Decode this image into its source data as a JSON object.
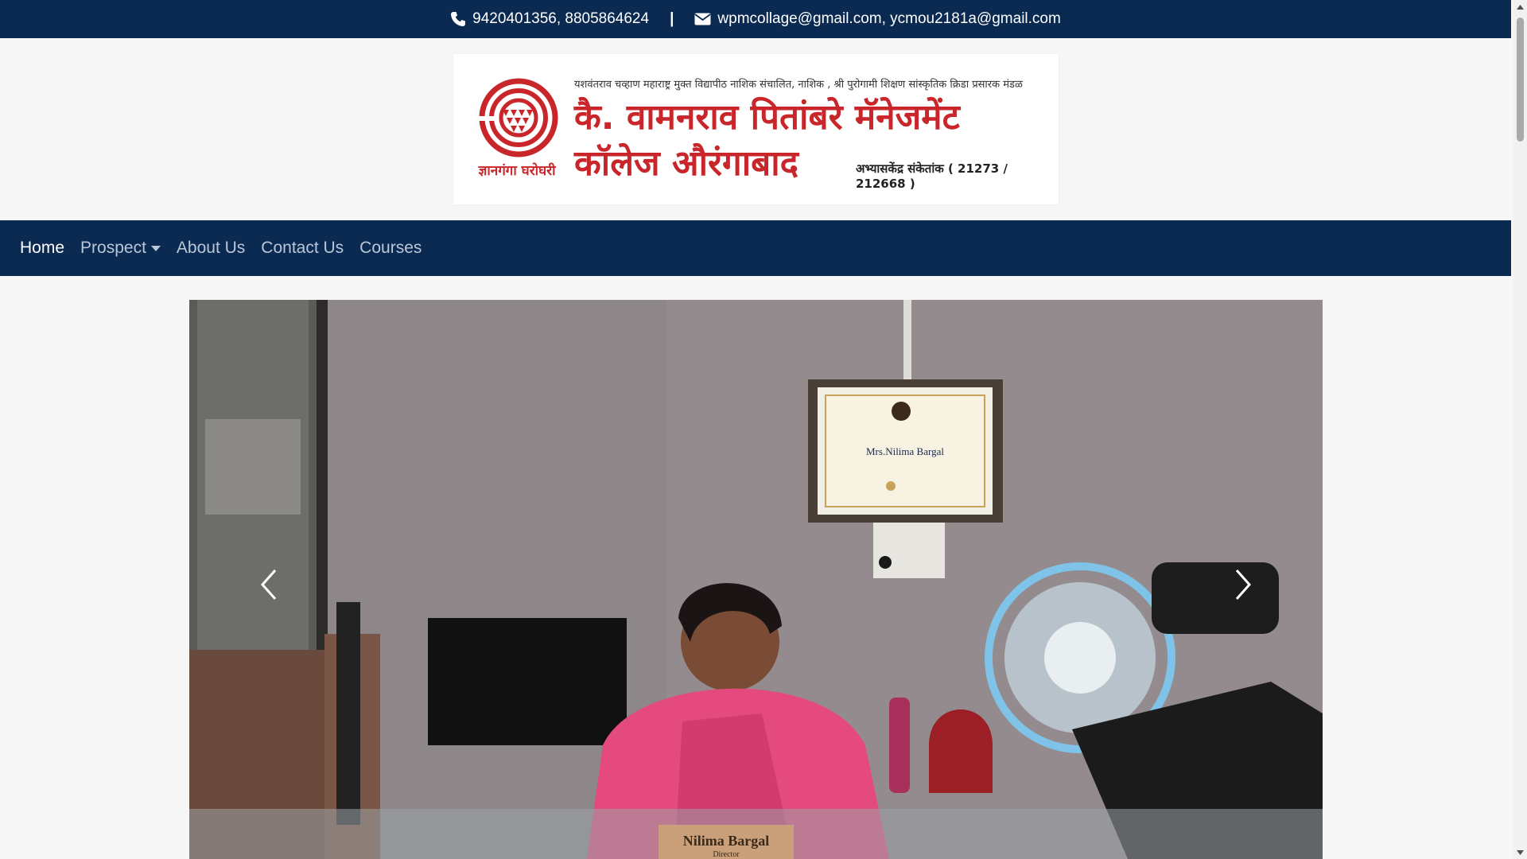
{
  "topbar": {
    "phone_icon": "phone-icon",
    "phones": "9420401356, 8805864624",
    "separator": "|",
    "email_icon": "envelope-icon",
    "emails": "wpmcollage@gmail.com, ycmou2181a@gmail.com"
  },
  "banner": {
    "emblem_icon": "ycmou-spiral-emblem",
    "tagline": "ज्ञानगंगा घरोघरी",
    "subtitle": "यशवंतराव चव्हाण महाराष्ट्र मुक्त विद्यापीठ नाशिक संचालित, नाशिक , श्री पुरोगामी शिक्षण सांस्कृतिक क्रिडा प्रसारक मंडळ",
    "title_line1": "कै. वामनराव पितांबरे मॅनेजमेंट",
    "title_line2": "कॉलेज औरंगाबाद",
    "center_code": "अभ्यासकेंद्र संकेतांक ( 21273 / 212668 )"
  },
  "nav": {
    "items": [
      {
        "label": "Home",
        "active": true
      },
      {
        "label": "Prospect",
        "dropdown": true
      },
      {
        "label": "About Us"
      },
      {
        "label": "Contact Us"
      },
      {
        "label": "Courses"
      }
    ]
  },
  "carousel": {
    "prev_icon": "chevron-left-icon",
    "next_icon": "chevron-right-icon",
    "slide": {
      "certificate_name": "Mrs.Nilima Bargal",
      "nameplate": "Nilima Bargal",
      "nameplate_sub": "Director"
    }
  },
  "colors": {
    "navy": "#0b2a52",
    "brand_red": "#c8262a",
    "nav_link": "#b9c7d8",
    "background": "#f6f6f6"
  }
}
